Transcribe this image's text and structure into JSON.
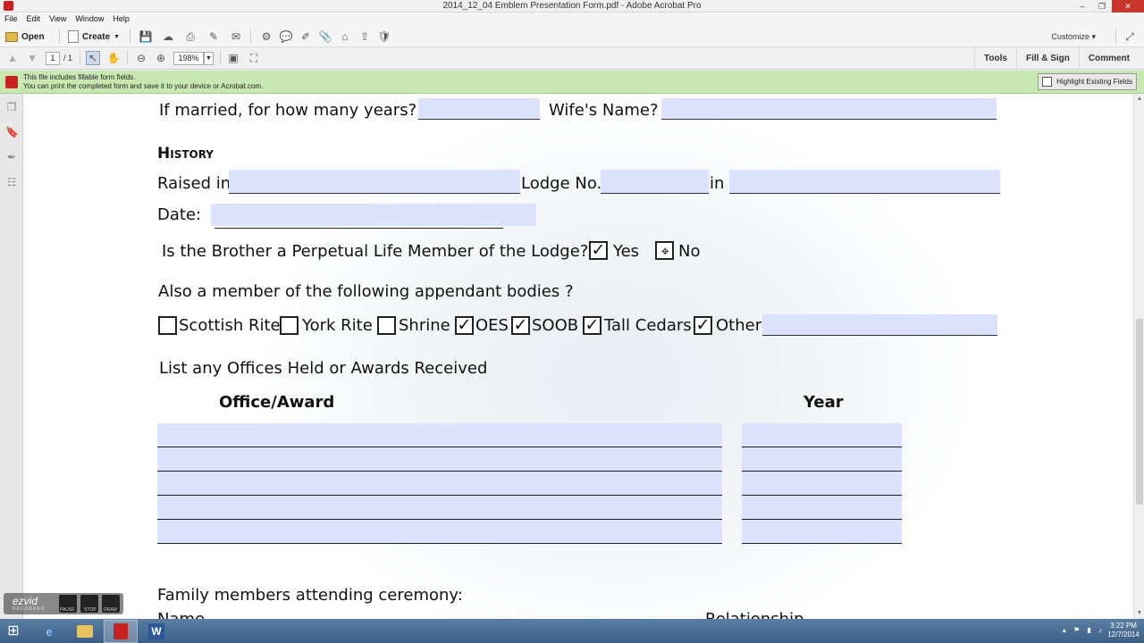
{
  "window": {
    "title": "2014_12_04 Emblem Presentation Form.pdf - Adobe Acrobat Pro",
    "min_glyph": "–",
    "restore_glyph": "❐",
    "close_glyph": "✕"
  },
  "menu": [
    "File",
    "Edit",
    "View",
    "Window",
    "Help"
  ],
  "toolbar": {
    "open_label": "Open",
    "create_label": "Create",
    "customize_label": "Customize"
  },
  "nav": {
    "page_current": "1",
    "page_total": "/ 1",
    "zoom": "198%",
    "tabs": [
      "Tools",
      "Fill & Sign",
      "Comment"
    ]
  },
  "notification": {
    "line1": "This file includes fillable form fields.",
    "line2": "You can print the completed form and save it to your device or Acrobat.com.",
    "highlight_label": "Highlight Existing Fields"
  },
  "form": {
    "married_label": "If married, for how many years?",
    "wife_label": "Wife's Name?",
    "history_heading": "History",
    "raised_label": "Raised in",
    "lodge_label": "Lodge No.",
    "in_label": "in",
    "date_label": "Date:",
    "perpetual_question": "Is the Brother a Perpetual Life Member of the Lodge?",
    "yes_label": "Yes",
    "no_label": "No",
    "yes_checked": true,
    "no_checked": false,
    "appendant_question": "Also a member of the following appendant bodies ?",
    "bodies": [
      {
        "label": "Scottish Rite",
        "checked": false
      },
      {
        "label": "York Rite",
        "checked": false
      },
      {
        "label": "Shrine",
        "checked": false
      },
      {
        "label": "OES",
        "checked": true
      },
      {
        "label": "SOOB",
        "checked": true
      },
      {
        "label": "Tall Cedars",
        "checked": true
      },
      {
        "label": "Other",
        "checked": true
      }
    ],
    "offices_heading": "List any Offices Held or Awards Received",
    "office_col": "Office/Award",
    "year_col": "Year",
    "family_heading": "Family members attending ceremony:",
    "name_col_partial": "Name",
    "relationship_col_partial": "Relationship",
    "check_glyph": "✓"
  },
  "overlay": {
    "logo": "ezvid",
    "sublabel": "RECORDER",
    "pause": "PAUSE",
    "stop": "STOP",
    "draw": "DRAW"
  },
  "taskbar": {
    "time": "3:22 PM",
    "date": "12/7/2014"
  }
}
